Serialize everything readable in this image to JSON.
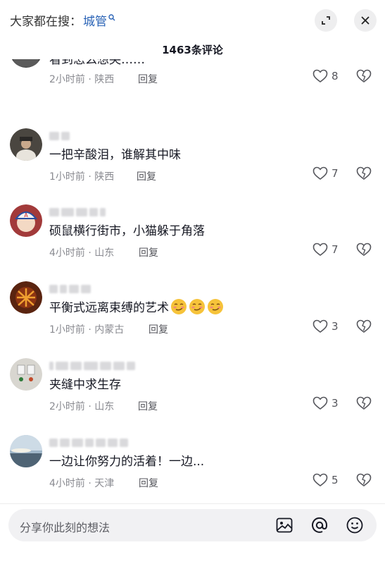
{
  "header": {
    "search_prefix": "大家都在搜：",
    "search_keyword": "城管",
    "icons": [
      "search-icon",
      "expand-icon",
      "close-icon"
    ]
  },
  "comment_count_title": "1463条评论",
  "comments": [
    {
      "text": "看到怎么想哭……",
      "meta": "2小时前 · 陕西",
      "reply": "回复",
      "likes": "8"
    },
    {
      "text": "一把辛酸泪，谁解其中味",
      "meta": "1小时前 · 陕西",
      "reply": "回复",
      "likes": "7"
    },
    {
      "text": "硕鼠横行街市，小猫躲于角落",
      "meta": "4小时前 · 山东",
      "reply": "回复",
      "likes": "7"
    },
    {
      "text": "平衡式远离束缚的艺术",
      "meta": "1小时前 · 内蒙古",
      "reply": "回复",
      "likes": "3"
    },
    {
      "text": "夹缝中求生存",
      "meta": "2小时前 · 山东",
      "reply": "回复",
      "likes": "3"
    },
    {
      "text": "一边让你努力的活着！一边...",
      "meta": "4小时前 · 天津",
      "reply": "回复",
      "likes": "5"
    }
  ],
  "input": {
    "placeholder": "分享你此刻的想法",
    "icons": [
      "image-icon",
      "at-icon",
      "emoji-icon"
    ]
  },
  "colors": {
    "keyword": "#2a63b6",
    "meta": "#8a8b91",
    "input_bg": "#f1f1f3"
  }
}
